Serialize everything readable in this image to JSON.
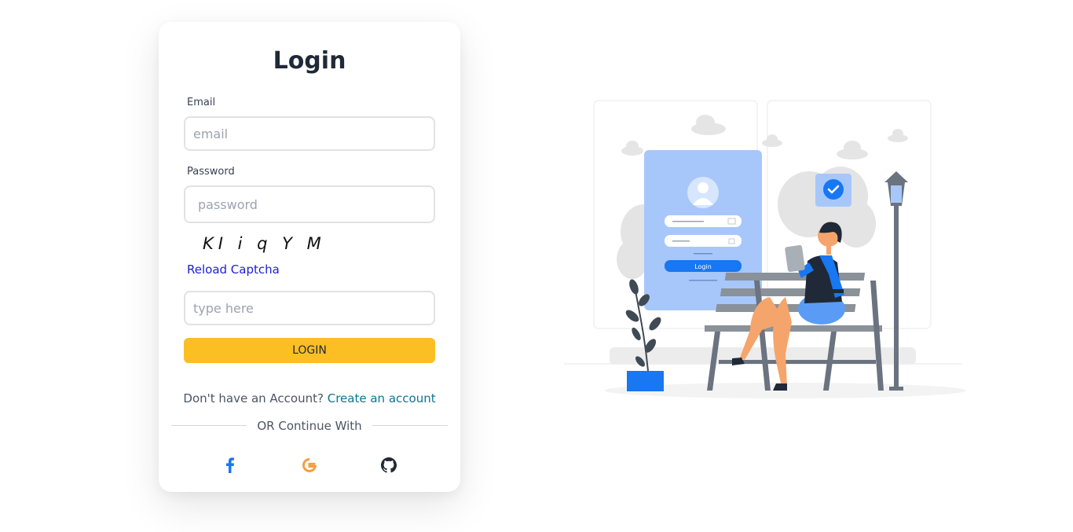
{
  "login": {
    "title": "Login",
    "email_label": "Email",
    "email_placeholder": "email",
    "password_label": "Password",
    "password_placeholder": "password",
    "captcha_text": "KI i q Y M",
    "reload_captcha": "Reload Captcha",
    "captcha_placeholder": "type here",
    "login_button": "LOGIN",
    "no_account_text": "Don't have an Account?",
    "create_account_link": "Create an account",
    "or_continue": "OR Continue With"
  },
  "social": {
    "icons": [
      "facebook-icon",
      "google-icon",
      "github-icon"
    ]
  },
  "colors": {
    "accent": "#fbbf24",
    "link": "#0e7490",
    "reload": "#1d1dd6",
    "facebook": "#1877f2",
    "google": "#f59e42",
    "github": "#1f2937",
    "illustration_blue": "#a7c7fb",
    "illustration_brand": "#1877f2"
  },
  "illustration": {
    "card_button": "Login"
  }
}
